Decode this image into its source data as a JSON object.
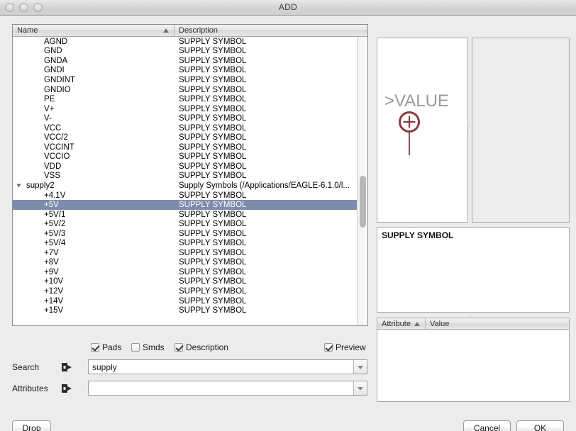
{
  "window": {
    "title": "ADD",
    "traffic_lights": [
      "close",
      "minimize",
      "zoom"
    ]
  },
  "list": {
    "columns": [
      {
        "label": "Name",
        "sorted": true
      },
      {
        "label": "Description",
        "sorted": false
      }
    ],
    "rows": [
      {
        "name": "AGND",
        "description": "SUPPLY SYMBOL",
        "type": "leaf",
        "selected": false
      },
      {
        "name": "GND",
        "description": "SUPPLY SYMBOL",
        "type": "leaf",
        "selected": false
      },
      {
        "name": "GNDA",
        "description": "SUPPLY SYMBOL",
        "type": "leaf",
        "selected": false
      },
      {
        "name": "GNDI",
        "description": "SUPPLY SYMBOL",
        "type": "leaf",
        "selected": false
      },
      {
        "name": "GNDINT",
        "description": "SUPPLY SYMBOL",
        "type": "leaf",
        "selected": false
      },
      {
        "name": "GNDIO",
        "description": "SUPPLY SYMBOL",
        "type": "leaf",
        "selected": false
      },
      {
        "name": "PE",
        "description": "SUPPLY SYMBOL",
        "type": "leaf",
        "selected": false
      },
      {
        "name": "V+",
        "description": "SUPPLY SYMBOL",
        "type": "leaf",
        "selected": false
      },
      {
        "name": "V-",
        "description": "SUPPLY SYMBOL",
        "type": "leaf",
        "selected": false
      },
      {
        "name": "VCC",
        "description": "SUPPLY SYMBOL",
        "type": "leaf",
        "selected": false
      },
      {
        "name": "VCC/2",
        "description": "SUPPLY SYMBOL",
        "type": "leaf",
        "selected": false
      },
      {
        "name": "VCCINT",
        "description": "SUPPLY SYMBOL",
        "type": "leaf",
        "selected": false
      },
      {
        "name": "VCCIO",
        "description": "SUPPLY SYMBOL",
        "type": "leaf",
        "selected": false
      },
      {
        "name": "VDD",
        "description": "SUPPLY SYMBOL",
        "type": "leaf",
        "selected": false
      },
      {
        "name": "VSS",
        "description": "SUPPLY SYMBOL",
        "type": "leaf",
        "selected": false
      },
      {
        "name": "supply2",
        "description": "Supply Symbols (/Applications/EAGLE-6.1.0/l...",
        "type": "group",
        "expanded": true,
        "selected": false
      },
      {
        "name": "+4.1V",
        "description": "SUPPLY SYMBOL",
        "type": "leaf",
        "selected": false
      },
      {
        "name": "+5V",
        "description": "SUPPLY SYMBOL",
        "type": "leaf",
        "selected": true
      },
      {
        "name": "+5V/1",
        "description": "SUPPLY SYMBOL",
        "type": "leaf",
        "selected": false
      },
      {
        "name": "+5V/2",
        "description": "SUPPLY SYMBOL",
        "type": "leaf",
        "selected": false
      },
      {
        "name": "+5V/3",
        "description": "SUPPLY SYMBOL",
        "type": "leaf",
        "selected": false
      },
      {
        "name": "+5V/4",
        "description": "SUPPLY SYMBOL",
        "type": "leaf",
        "selected": false
      },
      {
        "name": "+7V",
        "description": "SUPPLY SYMBOL",
        "type": "leaf",
        "selected": false
      },
      {
        "name": "+8V",
        "description": "SUPPLY SYMBOL",
        "type": "leaf",
        "selected": false
      },
      {
        "name": "+9V",
        "description": "SUPPLY SYMBOL",
        "type": "leaf",
        "selected": false
      },
      {
        "name": "+10V",
        "description": "SUPPLY SYMBOL",
        "type": "leaf",
        "selected": false
      },
      {
        "name": "+12V",
        "description": "SUPPLY SYMBOL",
        "type": "leaf",
        "selected": false
      },
      {
        "name": "+14V",
        "description": "SUPPLY SYMBOL",
        "type": "leaf",
        "selected": false
      },
      {
        "name": "+15V",
        "description": "SUPPLY SYMBOL",
        "type": "leaf",
        "selected": false
      }
    ],
    "selection_color": "#7d8cab"
  },
  "preview": {
    "symbol_value_text": ">VALUE",
    "symbol_color": "#8b3a43",
    "symbol_text_color": "#9a9a9a",
    "symbol_glyph": "supply-circle-plus-icon"
  },
  "description_panel": {
    "text": "SUPPLY SYMBOL"
  },
  "attributes_table": {
    "columns": [
      {
        "label": "Attribute",
        "sorted": true
      },
      {
        "label": "Value",
        "sorted": false
      }
    ],
    "rows": []
  },
  "checkboxes": [
    {
      "label": "Pads",
      "checked": true
    },
    {
      "label": "Smds",
      "checked": false
    },
    {
      "label": "Description",
      "checked": true
    },
    {
      "label": "Preview",
      "checked": true
    }
  ],
  "fields": {
    "search": {
      "label": "Search",
      "value": "supply",
      "placeholder": ""
    },
    "attributes": {
      "label": "Attributes",
      "value": "",
      "placeholder": ""
    }
  },
  "buttons": {
    "drop": "Drop",
    "cancel": "Cancel",
    "ok": "OK"
  }
}
